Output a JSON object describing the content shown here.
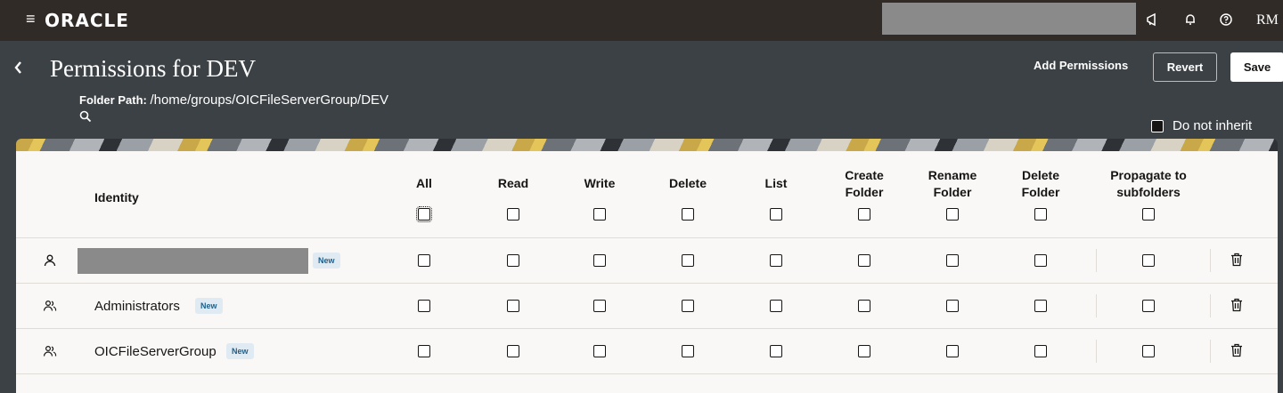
{
  "topbar": {
    "menu_icon": "hamburger-icon",
    "logo": "ORACLE",
    "icons": [
      "megaphone-icon",
      "bell-icon",
      "help-icon"
    ],
    "avatar_initials": "RM"
  },
  "header": {
    "title": "Permissions for DEV",
    "folder_path_label": "Folder Path: ",
    "folder_path_value": "/home/groups/OICFileServerGroup/DEV",
    "add_permissions": "Add Permissions",
    "revert": "Revert",
    "save": "Save",
    "do_not_inherit": "Do not inherit"
  },
  "table": {
    "identity_header": "Identity",
    "columns": [
      {
        "line1": "All",
        "line2": ""
      },
      {
        "line1": "Read",
        "line2": ""
      },
      {
        "line1": "Write",
        "line2": ""
      },
      {
        "line1": "Delete",
        "line2": ""
      },
      {
        "line1": "List",
        "line2": ""
      },
      {
        "line1": "Create",
        "line2": "Folder"
      },
      {
        "line1": "Rename",
        "line2": "Folder"
      },
      {
        "line1": "Delete",
        "line2": "Folder"
      },
      {
        "line1": "Propagate to",
        "line2": "subfolders"
      }
    ],
    "rows": [
      {
        "name": "",
        "icon": "user-icon",
        "badge": "New"
      },
      {
        "name": "Administrators",
        "icon": "group-icon",
        "badge": "New"
      },
      {
        "name": "OICFileServerGroup",
        "icon": "group-icon",
        "badge": "New"
      }
    ]
  }
}
